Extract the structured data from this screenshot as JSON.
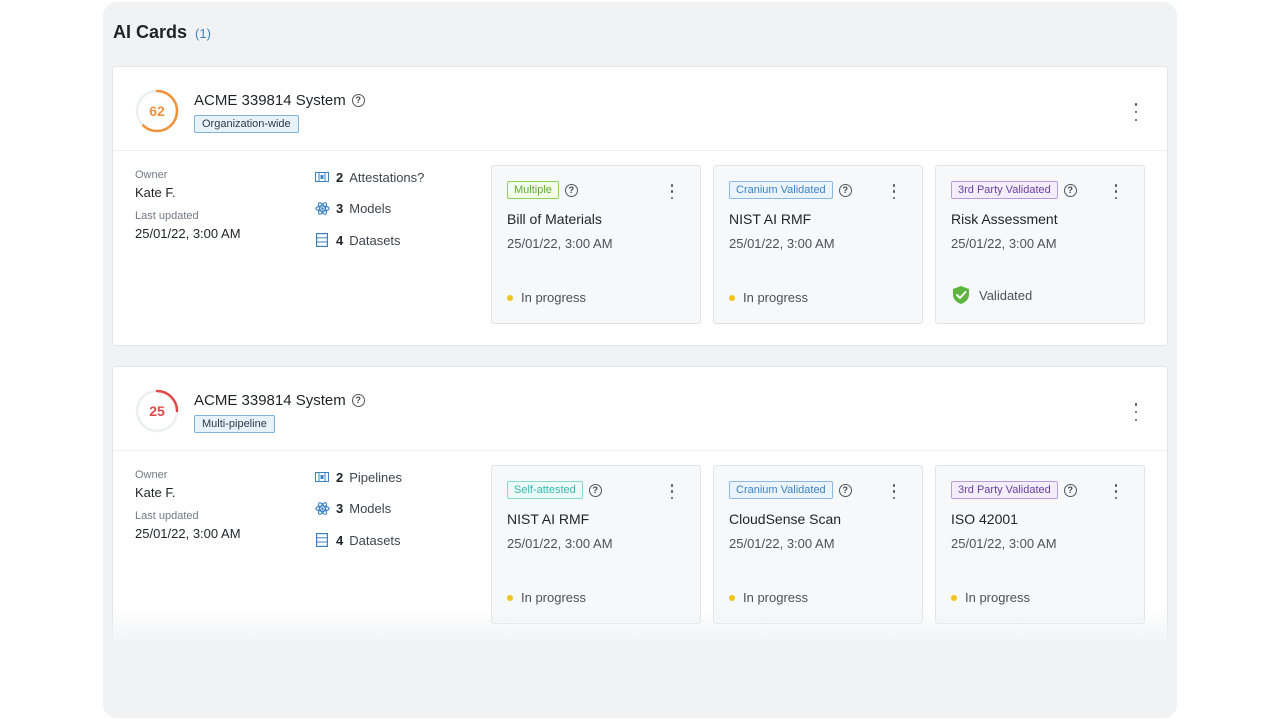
{
  "panel": {
    "title": "AI Cards",
    "count": "(1)"
  },
  "colors": {
    "accent": "#3b82c4",
    "score_orange": "#f0923a",
    "score_red": "#e24a4a",
    "in_progress": "#f2c31d",
    "validated": "#5cb53d"
  },
  "cards": [
    {
      "score": "62",
      "score_fraction": 0.62,
      "name": "ACME 339814 System",
      "help_icon": "question-circle-icon",
      "scope_tag": "Organization-wide",
      "owner_label": "Owner",
      "owner": "Kate F.",
      "updated_label": "Last updated",
      "updated": "25/01/22, 3:00 AM",
      "stats": [
        {
          "icon": "pipeline-icon",
          "count": "2",
          "label": "Attestations?"
        },
        {
          "icon": "atom-icon",
          "count": "3",
          "label": "Models"
        },
        {
          "icon": "dataset-icon",
          "count": "4",
          "label": "Datasets"
        }
      ],
      "items": [
        {
          "badge": "Multiple",
          "title": "Bill of Materials",
          "date": "25/01/22, 3:00 AM",
          "status": "In progress"
        },
        {
          "badge": "Cranium Validated",
          "title": "NIST AI RMF",
          "date": "25/01/22, 3:00 AM",
          "status": "In progress"
        },
        {
          "badge": "3rd Party Validated",
          "title": "Risk Assessment",
          "date": "25/01/22, 3:00 AM",
          "status": "Validated"
        }
      ]
    },
    {
      "score": "25",
      "score_fraction": 0.25,
      "name": "ACME 339814 System",
      "help_icon": "question-circle-icon",
      "scope_tag": "Multi-pipeline",
      "owner_label": "Owner",
      "owner": "Kate F.",
      "updated_label": "Last updated",
      "updated": "25/01/22, 3:00 AM",
      "stats": [
        {
          "icon": "pipeline-icon",
          "count": "2",
          "label": "Pipelines"
        },
        {
          "icon": "atom-icon",
          "count": "3",
          "label": "Models"
        },
        {
          "icon": "dataset-icon",
          "count": "4",
          "label": "Datasets"
        }
      ],
      "items": [
        {
          "badge": "Self-attested",
          "title": "NIST AI RMF",
          "date": "25/01/22, 3:00 AM",
          "status": "In progress"
        },
        {
          "badge": "Cranium Validated",
          "title": "CloudSense Scan",
          "date": "25/01/22, 3:00 AM",
          "status": "In progress"
        },
        {
          "badge": "3rd Party Validated",
          "title": "ISO 42001",
          "date": "25/01/22, 3:00 AM",
          "status": "In progress"
        }
      ]
    }
  ]
}
